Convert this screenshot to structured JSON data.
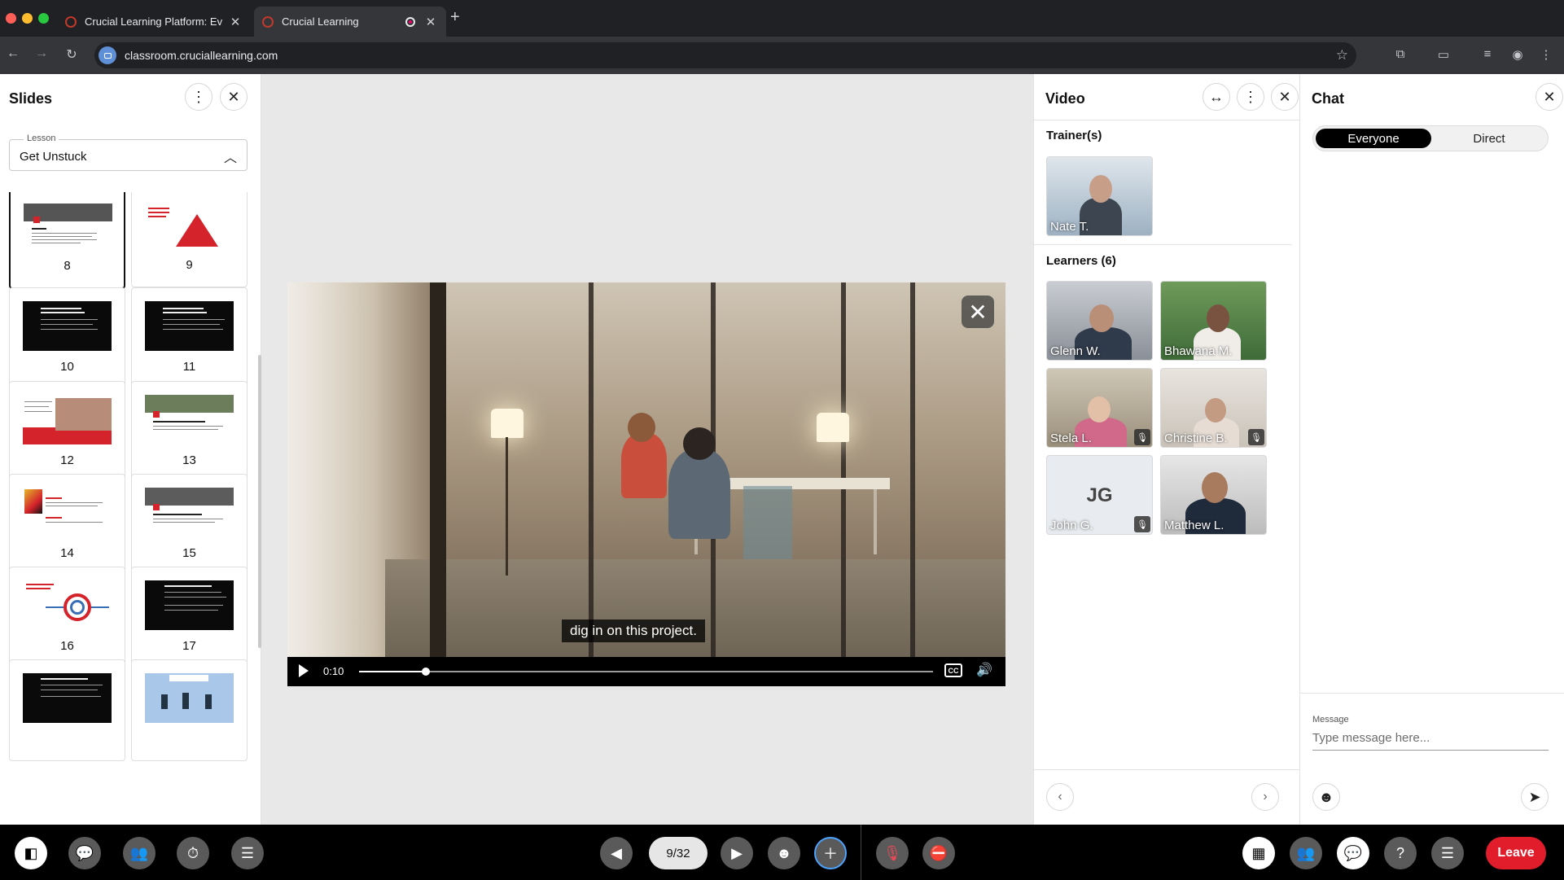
{
  "browser": {
    "tabs": [
      {
        "title": "Crucial Learning Platform: Ev",
        "active": false
      },
      {
        "title": "Crucial Learning",
        "active": true
      }
    ],
    "url": "classroom.cruciallearning.com"
  },
  "slides_panel": {
    "title": "Slides",
    "lesson_label": "Lesson",
    "lesson_value": "Get Unstuck",
    "slides": [
      {
        "number": "8",
        "style": "white",
        "selected": true
      },
      {
        "number": "9",
        "style": "white",
        "selected": false
      },
      {
        "number": "10",
        "style": "dark",
        "selected": false
      },
      {
        "number": "11",
        "style": "dark",
        "selected": false
      },
      {
        "number": "12",
        "style": "white",
        "selected": false
      },
      {
        "number": "13",
        "style": "white",
        "selected": false
      },
      {
        "number": "14",
        "style": "white",
        "selected": false
      },
      {
        "number": "15",
        "style": "white",
        "selected": false
      },
      {
        "number": "16",
        "style": "white",
        "selected": false
      },
      {
        "number": "17",
        "style": "dark",
        "selected": false
      },
      {
        "number": "",
        "style": "dark",
        "selected": false
      },
      {
        "number": "",
        "style": "blue",
        "selected": false
      }
    ]
  },
  "video_player": {
    "caption": "dig in on this project.",
    "time": "0:10",
    "progress": 0.117,
    "cc_label": "CC"
  },
  "video_panel": {
    "title": "Video",
    "trainers_label": "Trainer(s)",
    "trainers": [
      {
        "name": "Nate T."
      }
    ],
    "learners_label": "Learners (6)",
    "learners": [
      {
        "name": "Glenn W.",
        "initials": "",
        "muted": false
      },
      {
        "name": "Bhawana M.",
        "initials": "",
        "muted": false
      },
      {
        "name": "Stela L.",
        "initials": "",
        "muted": true
      },
      {
        "name": "Christine B.",
        "initials": "",
        "muted": true
      },
      {
        "name": "John G.",
        "initials": "JG",
        "muted": true
      },
      {
        "name": "Matthew L.",
        "initials": "",
        "muted": false
      }
    ]
  },
  "chat_panel": {
    "title": "Chat",
    "tabs": [
      "Everyone",
      "Direct"
    ],
    "active_tab": "Everyone",
    "message_label": "Message",
    "message_placeholder": "Type message here..."
  },
  "bottom_bar": {
    "page_indicator": "9/32",
    "leave_label": "Leave"
  },
  "colors": {
    "leave": "#e21d2b",
    "accent_red": "#d4232b",
    "stage_bg": "#e8e8e8"
  }
}
